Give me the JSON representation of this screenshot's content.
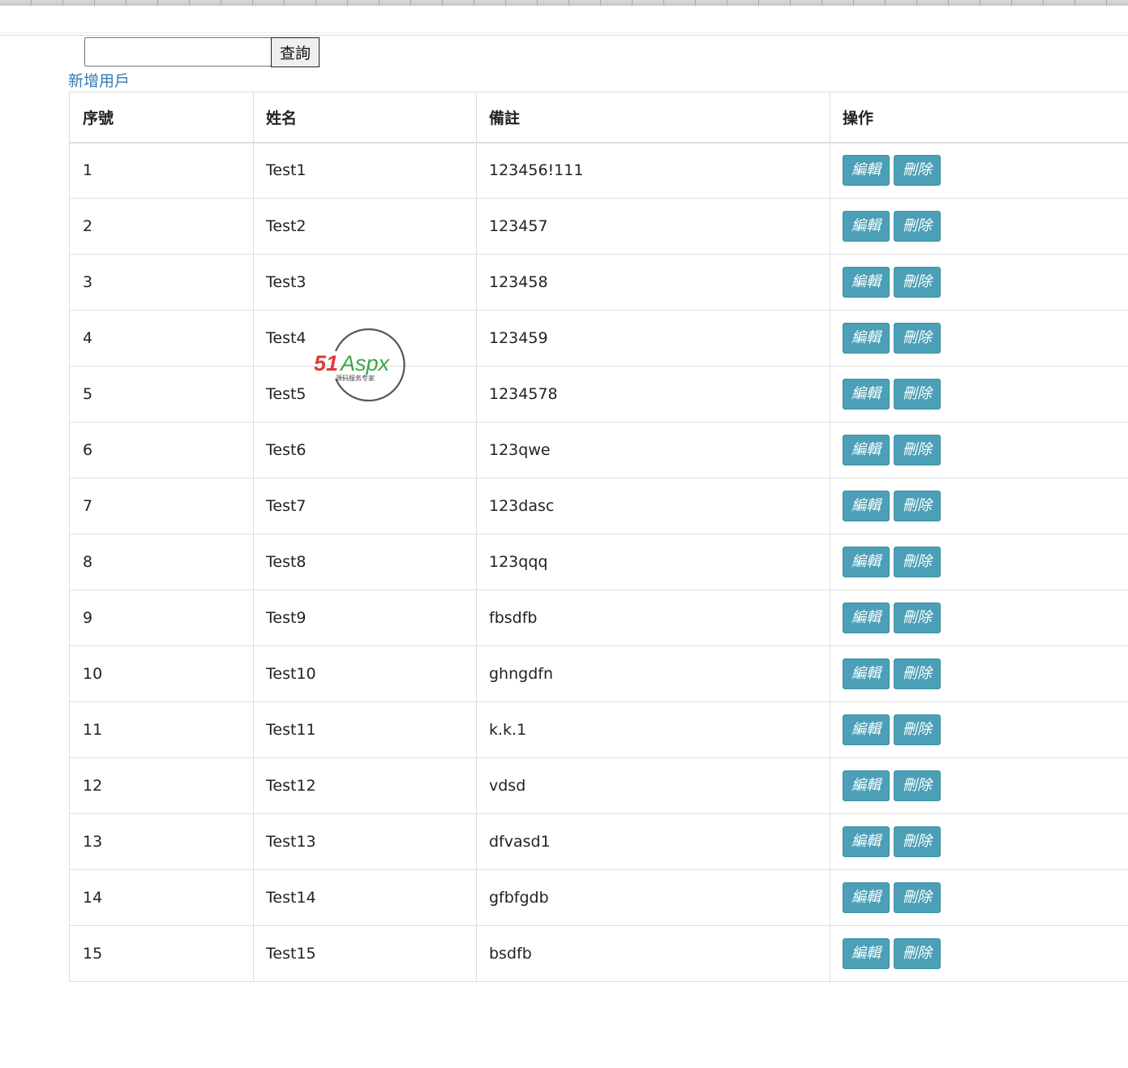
{
  "search": {
    "value": "",
    "placeholder": "",
    "button_label": "查詢"
  },
  "add_user_link": "新增用戶",
  "table": {
    "headers": {
      "index": "序號",
      "name": "姓名",
      "remark": "備註",
      "actions": "操作"
    },
    "edit_label": "編輯",
    "delete_label": "刪除",
    "rows": [
      {
        "index": "1",
        "name": "Test1",
        "remark": "123456!111"
      },
      {
        "index": "2",
        "name": "Test2",
        "remark": "123457"
      },
      {
        "index": "3",
        "name": "Test3",
        "remark": "123458"
      },
      {
        "index": "4",
        "name": "Test4",
        "remark": "123459"
      },
      {
        "index": "5",
        "name": "Test5",
        "remark": "1234578"
      },
      {
        "index": "6",
        "name": "Test6",
        "remark": "123qwe"
      },
      {
        "index": "7",
        "name": "Test7",
        "remark": "123dasc"
      },
      {
        "index": "8",
        "name": "Test8",
        "remark": "123qqq"
      },
      {
        "index": "9",
        "name": "Test9",
        "remark": "fbsdfb"
      },
      {
        "index": "10",
        "name": "Test10",
        "remark": "ghngdfn"
      },
      {
        "index": "11",
        "name": "Test11",
        "remark": "k.k.1"
      },
      {
        "index": "12",
        "name": "Test12",
        "remark": "vdsd"
      },
      {
        "index": "13",
        "name": "Test13",
        "remark": "dfvasd1"
      },
      {
        "index": "14",
        "name": "Test14",
        "remark": "gfbfgdb"
      },
      {
        "index": "15",
        "name": "Test15",
        "remark": "bsdfb"
      }
    ]
  },
  "watermark": {
    "brand_red": "51",
    "brand_rest": "Aspx",
    "tagline": "源码服务专家"
  },
  "colors": {
    "link": "#337ab7",
    "action_button": "#4ba0b7",
    "watermark_red": "#e03a3a",
    "watermark_green": "#3aa849"
  }
}
